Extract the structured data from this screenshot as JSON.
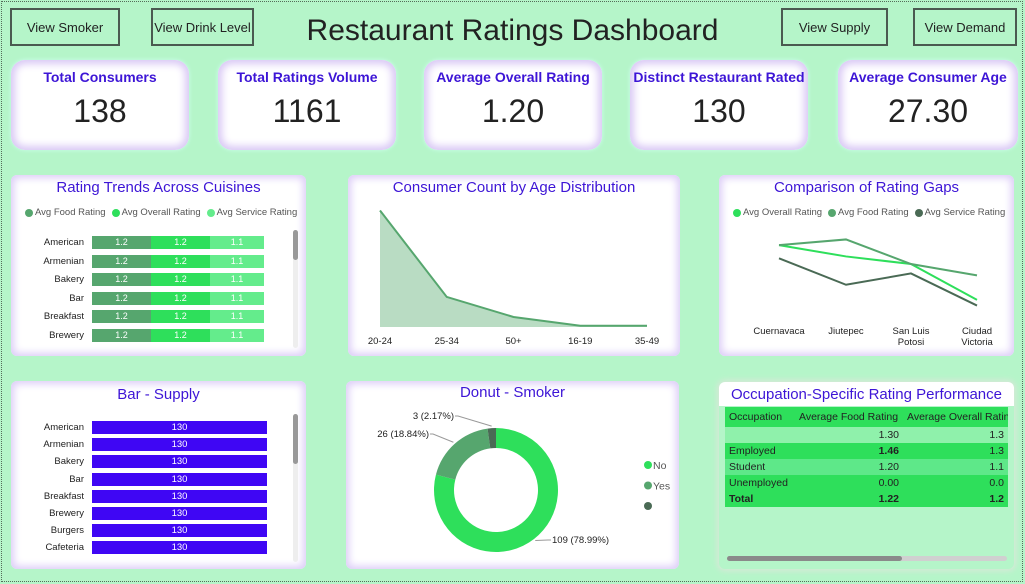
{
  "header": {
    "title": "Restaurant Ratings Dashboard",
    "buttons": [
      "View Smoker",
      "View Drink Level",
      "View Supply",
      "View Demand"
    ]
  },
  "kpis": [
    {
      "label": "Total Consumers",
      "value": "138"
    },
    {
      "label": "Total Ratings Volume",
      "value": "1161"
    },
    {
      "label": "Average Overall Rating",
      "value": "1.20"
    },
    {
      "label": "Distinct Restaurant Rated",
      "value": "130"
    },
    {
      "label": "Average Consumer Age",
      "value": "27.30"
    }
  ],
  "colors": {
    "background": "#b5f5c9",
    "accent_text": "#3d15d6",
    "food": "#56a66e",
    "overall": "#2edf5b",
    "service": "#64ec8c",
    "supply": "#3f06f4",
    "gap_service": "#4a6a55",
    "table_head": "#2edf5b"
  },
  "chart_data": [
    {
      "type": "bar",
      "title": "Rating Trends Across Cuisines",
      "categories": [
        "American",
        "Armenian",
        "Bakery",
        "Bar",
        "Breakfast",
        "Brewery"
      ],
      "series": [
        {
          "name": "Avg Food Rating",
          "values": [
            1.2,
            1.2,
            1.2,
            1.2,
            1.2,
            1.2
          ]
        },
        {
          "name": "Avg Overall Rating",
          "values": [
            1.2,
            1.2,
            1.2,
            1.2,
            1.2,
            1.2
          ]
        },
        {
          "name": "Avg Service Rating",
          "values": [
            1.1,
            1.1,
            1.1,
            1.1,
            1.1,
            1.1
          ]
        }
      ],
      "labels": [
        "1.2",
        "1.2",
        "1.1"
      ]
    },
    {
      "type": "area",
      "title": "Consumer Count by Age Distribution",
      "categories": [
        "20-24",
        "25-34",
        "50+",
        "16-19",
        "35-49"
      ],
      "values": [
        93,
        24,
        8,
        1,
        1
      ]
    },
    {
      "type": "line",
      "title": "Comparison of Rating Gaps",
      "categories": [
        "Cuernavaca",
        "Jiutepec",
        "San Luis Potosi",
        "Ciudad Victoria"
      ],
      "series": [
        {
          "name": "Avg Overall Rating",
          "values": [
            1.27,
            1.21,
            1.17,
            0.98
          ]
        },
        {
          "name": "Avg Food Rating",
          "values": [
            1.27,
            1.3,
            1.17,
            1.11
          ]
        },
        {
          "name": "Avg Service Rating",
          "values": [
            1.2,
            1.06,
            1.12,
            0.95
          ]
        }
      ]
    },
    {
      "type": "bar",
      "title": "Bar - Supply",
      "categories": [
        "American",
        "Armenian",
        "Bakery",
        "Bar",
        "Breakfast",
        "Brewery",
        "Burgers",
        "Cafeteria"
      ],
      "values": [
        130,
        130,
        130,
        130,
        130,
        130,
        130,
        130
      ]
    },
    {
      "type": "pie",
      "title": "Donut - Smoker",
      "categories": [
        "No",
        "Yes",
        ""
      ],
      "values": [
        109,
        26,
        3
      ],
      "labels": [
        "109 (78.99%)",
        "26 (18.84%)",
        "3 (2.17%)"
      ]
    }
  ],
  "age_labels": [
    "20-24",
    "25-34",
    "50+",
    "16-19",
    "35-49"
  ],
  "gap_labels": [
    "Cuernavaca",
    "Jiutepec",
    "San Luis\nPotosi",
    "Ciudad\nVictoria"
  ],
  "donut_legend": [
    "No",
    "Yes",
    ""
  ],
  "table": {
    "title": "Occupation-Specific Rating Performance",
    "headers": [
      "Occupation",
      "Average Food Rating",
      "Average Overall Ratin"
    ],
    "rows": [
      [
        "",
        "1.30",
        "1.3"
      ],
      [
        "Employed",
        "1.46",
        "1.3"
      ],
      [
        "Student",
        "1.20",
        "1.1"
      ],
      [
        "Unemployed",
        "0.00",
        "0.0"
      ]
    ],
    "total": [
      "Total",
      "1.22",
      "1.2"
    ]
  }
}
